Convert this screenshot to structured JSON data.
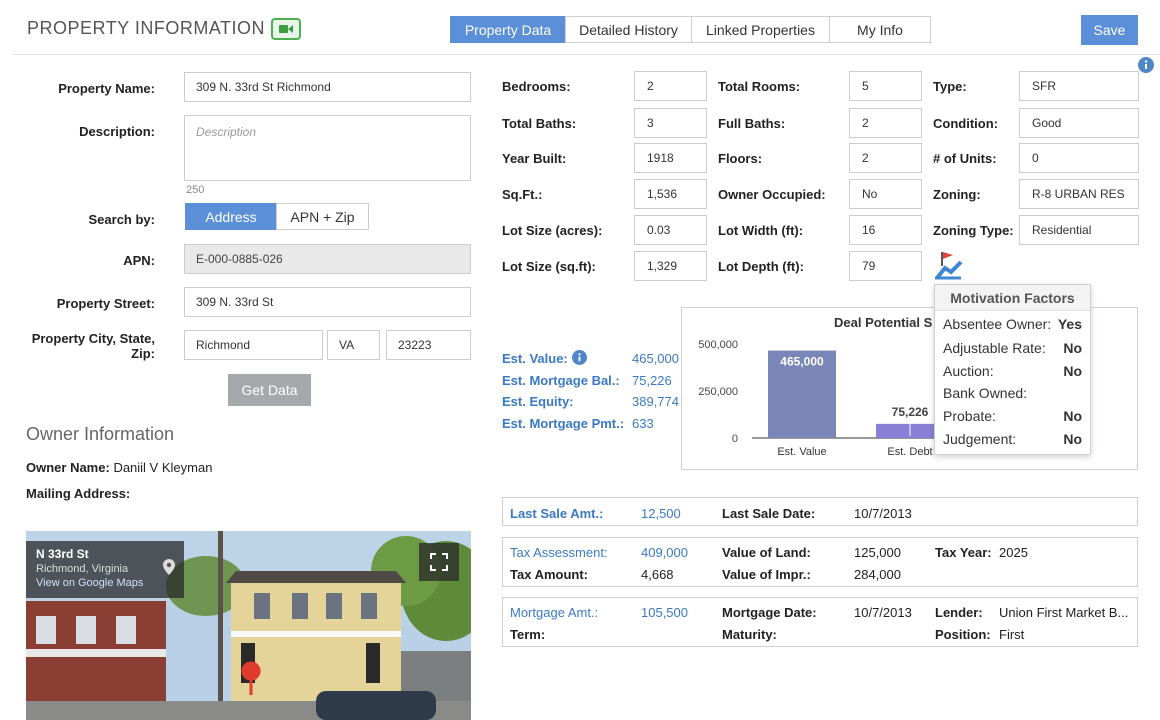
{
  "header": {
    "title": "PROPERTY INFORMATION",
    "tabs": [
      "Property Data",
      "Detailed History",
      "Linked Properties",
      "My Info"
    ],
    "save_label": "Save"
  },
  "form": {
    "property_name_label": "Property Name:",
    "property_name": "309 N. 33rd St Richmond",
    "description_label": "Description:",
    "description_placeholder": "Description",
    "char_count": "250",
    "search_by_label": "Search by:",
    "search_options": [
      "Address",
      "APN + Zip"
    ],
    "apn_label": "APN:",
    "apn": "E-000-0885-026",
    "street_label": "Property Street:",
    "street": "309 N. 33rd St",
    "city_label_1": "Property City, State,",
    "city_label_2": "Zip:",
    "city": "Richmond",
    "state": "VA",
    "zip": "23223",
    "get_data_label": "Get Data"
  },
  "owner": {
    "section_title": "Owner Information",
    "owner_name_label": "Owner Name:",
    "owner_name": "Daniil V Kleyman",
    "mailing_label": "Mailing Address:"
  },
  "map": {
    "street": "N 33rd St",
    "city": "Richmond, Virginia",
    "link": "View on Google Maps"
  },
  "details": {
    "col1": [
      {
        "label": "Bedrooms:",
        "value": "2"
      },
      {
        "label": "Total Baths:",
        "value": "3"
      },
      {
        "label": "Year Built:",
        "value": "1918"
      },
      {
        "label": "Sq.Ft.:",
        "value": "1,536"
      },
      {
        "label": "Lot Size (acres):",
        "value": "0.03"
      },
      {
        "label": "Lot Size (sq.ft):",
        "value": "1,329"
      }
    ],
    "col2": [
      {
        "label": "Total Rooms:",
        "value": "5"
      },
      {
        "label": "Full Baths:",
        "value": "2"
      },
      {
        "label": "Floors:",
        "value": "2"
      },
      {
        "label": "Owner Occupied:",
        "value": "No"
      },
      {
        "label": "Lot Width (ft):",
        "value": "16"
      },
      {
        "label": "Lot Depth (ft):",
        "value": "79"
      }
    ],
    "col3": [
      {
        "label": "Type:",
        "value": "SFR"
      },
      {
        "label": "Condition:",
        "value": "Good"
      },
      {
        "label": "# of Units:",
        "value": "0"
      },
      {
        "label": "Zoning:",
        "value": "R-8 URBAN RES"
      },
      {
        "label": "Zoning Type:",
        "value": "Residential"
      }
    ]
  },
  "estimates": [
    {
      "label": "Est. Value:",
      "value": "465,000"
    },
    {
      "label": "Est. Mortgage Bal.:",
      "value": "75,226"
    },
    {
      "label": "Est. Equity:",
      "value": "389,774"
    },
    {
      "label": "Est. Mortgage Pmt.:",
      "value": "633"
    }
  ],
  "chart_data": {
    "type": "bar",
    "title": "Deal Potential S",
    "categories": [
      "Est. Value",
      "Est. Debt"
    ],
    "values": [
      465000,
      75226
    ],
    "data_labels": [
      "465,000",
      "75,226"
    ],
    "y_ticks": [
      "500,000",
      "250,000",
      "0"
    ],
    "ylim": [
      0,
      500000
    ],
    "colors": [
      "#7b86b8",
      "#8a7fd6"
    ]
  },
  "motivation": {
    "title": "Motivation Factors",
    "rows": [
      {
        "label": "Absentee Owner:",
        "value": "Yes"
      },
      {
        "label": "Adjustable Rate:",
        "value": "No"
      },
      {
        "label": "Auction:",
        "value": "No"
      },
      {
        "label": "Bank Owned:",
        "value": ""
      },
      {
        "label": "Probate:",
        "value": "No"
      },
      {
        "label": "Judgement:",
        "value": "No"
      }
    ]
  },
  "sale": {
    "last_sale_amt_label": "Last Sale Amt.:",
    "last_sale_amt": "12,500",
    "last_sale_date_label": "Last Sale Date:",
    "last_sale_date": "10/7/2013"
  },
  "tax": {
    "assessment_label": "Tax Assessment:",
    "assessment": "409,000",
    "amount_label": "Tax Amount:",
    "amount": "4,668",
    "land_label": "Value of Land:",
    "land": "125,000",
    "impr_label": "Value of Impr.:",
    "impr": "284,000",
    "year_label": "Tax Year:",
    "year": "2025"
  },
  "mortgage": {
    "amt_label": "Mortgage Amt.:",
    "amt": "105,500",
    "term_label": "Term:",
    "date_label": "Mortgage Date:",
    "date": "10/7/2013",
    "maturity_label": "Maturity:",
    "lender_label": "Lender:",
    "lender": "Union First Market B...",
    "position_label": "Position:",
    "position": "First"
  }
}
